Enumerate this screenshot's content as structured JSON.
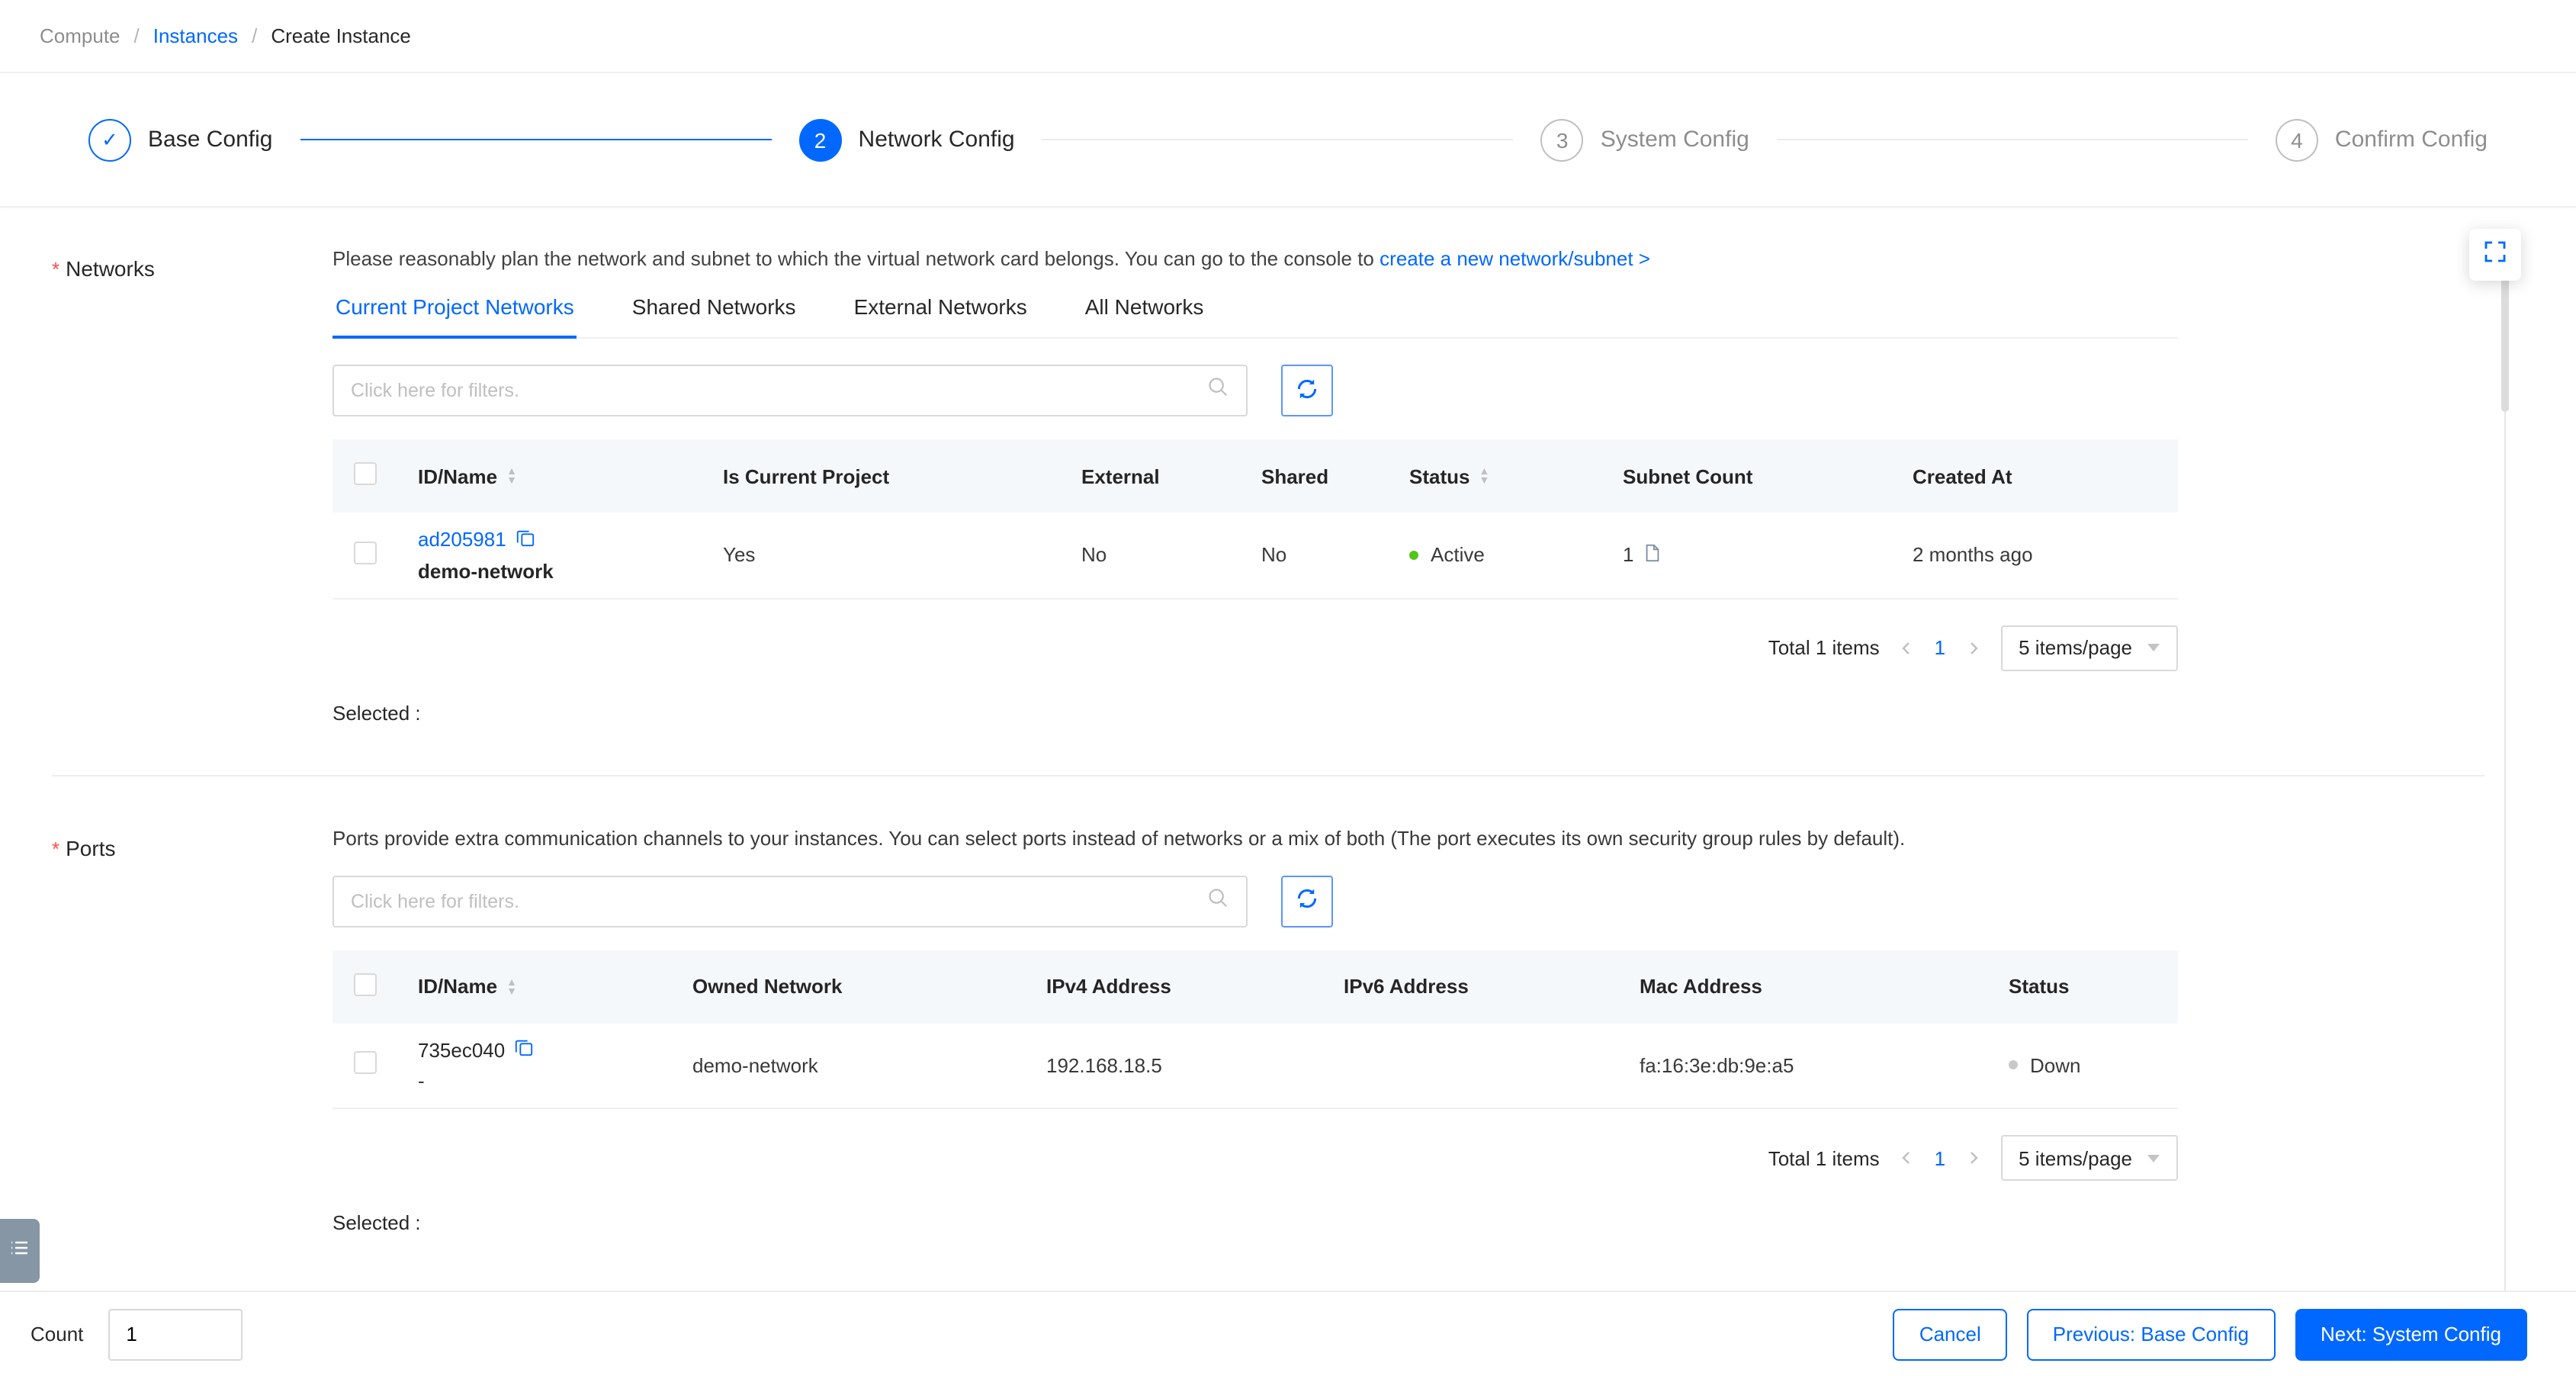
{
  "breadcrumb": {
    "separator": "/",
    "items": [
      "Compute",
      "Instances",
      "Create Instance"
    ]
  },
  "steps": {
    "items": [
      {
        "num": "1",
        "label": "Base Config",
        "state": "done"
      },
      {
        "num": "2",
        "label": "Network Config",
        "state": "active"
      },
      {
        "num": "3",
        "label": "System Config",
        "state": "pending"
      },
      {
        "num": "4",
        "label": "Confirm Config",
        "state": "pending"
      }
    ],
    "done_glyph": "✓"
  },
  "networks": {
    "required_mark": "*",
    "label": "Networks",
    "notice_text": "Please reasonably plan the network and subnet to which the virtual network card belongs. You can go to the console to",
    "notice_link": "create a new network/subnet >",
    "tabs": [
      "Current Project Networks",
      "Shared Networks",
      "External Networks",
      "All Networks"
    ],
    "active_tab": "Current Project Networks",
    "filter_placeholder": "Click here for filters.",
    "columns": [
      "ID/Name",
      "Is Current Project",
      "External",
      "Shared",
      "Status",
      "Subnet Count",
      "Created At"
    ],
    "row": {
      "id": "ad205981",
      "name": "demo-network",
      "is_current_project": "Yes",
      "external": "No",
      "shared": "No",
      "status": "Active",
      "subnet_count": "1",
      "created_at": "2 months ago"
    },
    "pagination": {
      "total": "Total 1 items",
      "page": "1",
      "page_size": "5 items/page"
    },
    "selected_label": "Selected :"
  },
  "ports": {
    "required_mark": "*",
    "label": "Ports",
    "description": "Ports provide extra communication channels to your instances. You can select ports instead of networks or a mix of both (The port executes its own security group rules by default).",
    "filter_placeholder": "Click here for filters.",
    "columns": [
      "ID/Name",
      "Owned Network",
      "IPv4 Address",
      "IPv6 Address",
      "Mac Address",
      "Status"
    ],
    "row": {
      "id": "735ec040",
      "name": "-",
      "owned_network": "demo-network",
      "ipv4": "192.168.18.5",
      "ipv6": "",
      "mac": "fa:16:3e:db:9e:a5",
      "status": "Down"
    },
    "pagination": {
      "total": "Total 1 items",
      "page": "1",
      "page_size": "5 items/page"
    },
    "selected_label": "Selected :"
  },
  "footer": {
    "count_label": "Count",
    "count_value": "1",
    "cancel_label": "Cancel",
    "previous_label": "Previous: Base Config",
    "next_label": "Next: System Config"
  },
  "colors": {
    "primary": "#0068ff",
    "link": "#0068ff",
    "status_active": "#52c41a",
    "status_down": "#c9c9c9",
    "required": "#ff4d4f",
    "table_header_bg": "#f5f8fb"
  }
}
